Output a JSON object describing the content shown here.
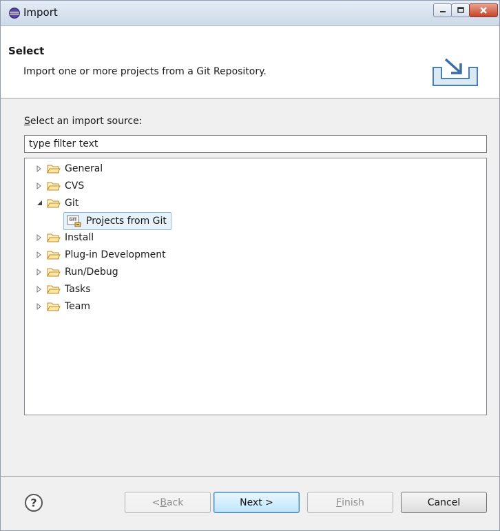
{
  "window": {
    "title": "Import",
    "controls": [
      "minimize",
      "maximize",
      "close"
    ]
  },
  "header": {
    "title": "Select",
    "description": "Import one or more projects from a Git Repository.",
    "icon": "import-wizard-icon"
  },
  "source": {
    "label_mnemonic": "S",
    "label_rest": "elect an import source:",
    "filter_value": "type filter text"
  },
  "tree": {
    "items": [
      {
        "label": "General",
        "expanded": false
      },
      {
        "label": "CVS",
        "expanded": false
      },
      {
        "label": "Git",
        "expanded": true
      },
      {
        "label": "Projects from Git",
        "child": true,
        "selected": true
      },
      {
        "label": "Install",
        "expanded": false
      },
      {
        "label": "Plug-in Development",
        "expanded": false
      },
      {
        "label": "Run/Debug",
        "expanded": false
      },
      {
        "label": "Tasks",
        "expanded": false
      },
      {
        "label": "Team",
        "expanded": false
      }
    ]
  },
  "buttons": {
    "back_pre": "< ",
    "back_mnemonic": "B",
    "back_rest": "ack",
    "next": "Next >",
    "finish_mnemonic": "F",
    "finish_rest": "inish",
    "cancel": "Cancel"
  },
  "colors": {
    "selection": "#e7f2fb",
    "default_button": "#bee6fd"
  }
}
